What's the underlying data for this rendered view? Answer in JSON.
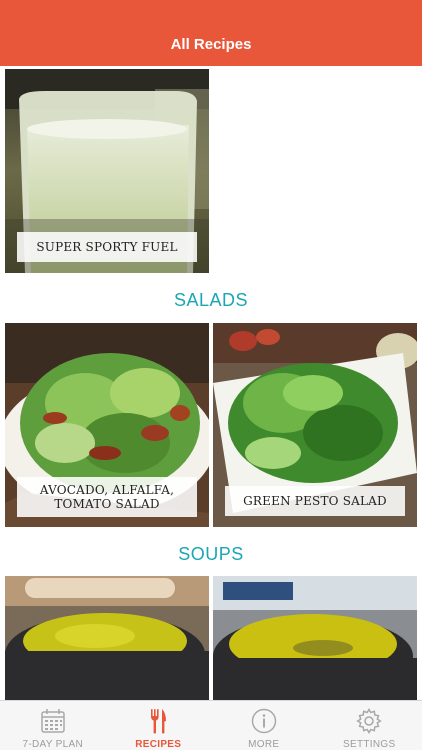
{
  "header": {
    "title": "All Recipes"
  },
  "sections": [
    {
      "title": ""
    },
    {
      "title": "SALADS"
    },
    {
      "title": "SOUPS"
    }
  ],
  "recipes": {
    "smoothie": {
      "label": "SUPER SPORTY FUEL"
    },
    "avocado_salad": {
      "label": "AVOCADO, ALFALFA, TOMATO SALAD"
    },
    "pesto_salad": {
      "label": "GREEN PESTO SALAD"
    },
    "soup_1": {
      "label": ""
    },
    "soup_2": {
      "label": ""
    }
  },
  "tabs": [
    {
      "label": "7-DAY PLAN",
      "icon": "calendar-icon",
      "active": false
    },
    {
      "label": "RECIPES",
      "icon": "fork-knife-icon",
      "active": true
    },
    {
      "label": "MORE",
      "icon": "info-icon",
      "active": false
    },
    {
      "label": "SETTINGS",
      "icon": "gear-icon",
      "active": false
    }
  ],
  "colors": {
    "header": "#e8573a",
    "section_title": "#1aa7b3",
    "active_tab": "#e8573a",
    "inactive_tab": "#9c9c9c"
  }
}
